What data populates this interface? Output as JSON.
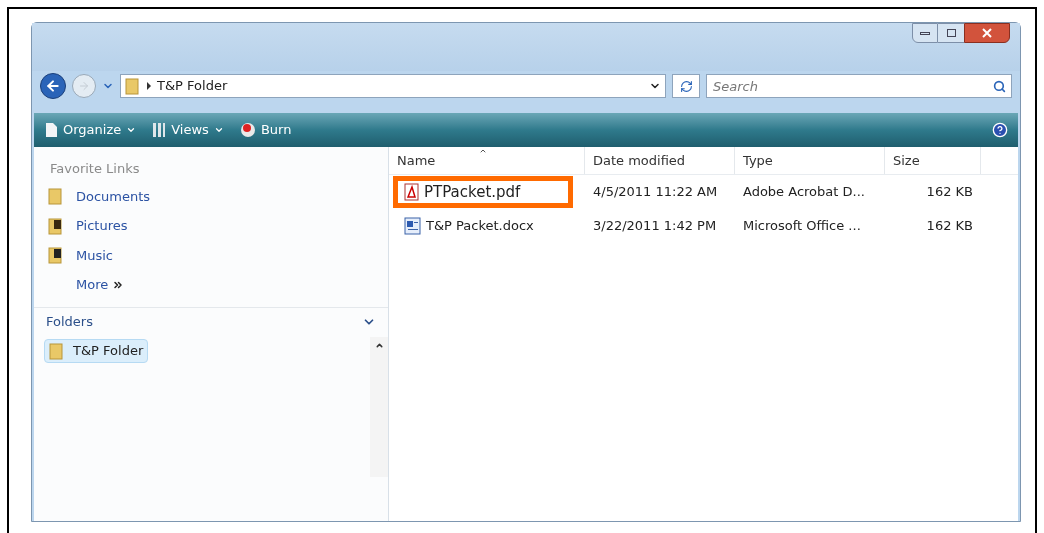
{
  "address_bar": {
    "path": "T&P Folder"
  },
  "search": {
    "placeholder": "Search"
  },
  "toolbar": [
    {
      "kind": "organize",
      "label": "Organize"
    },
    {
      "kind": "views",
      "label": "Views"
    },
    {
      "kind": "burn",
      "label": "Burn"
    }
  ],
  "sidebar": {
    "favorites_title": "Favorite Links",
    "links": [
      {
        "kind": "documents",
        "label": "Documents"
      },
      {
        "kind": "pictures",
        "label": "Pictures"
      },
      {
        "kind": "music",
        "label": "Music"
      }
    ],
    "more": "More",
    "folders_title": "Folders",
    "tree": [
      {
        "label": "T&P Folder",
        "selected": true
      }
    ]
  },
  "table": {
    "columns": [
      "Name",
      "Date modified",
      "Type",
      "Size"
    ],
    "rows": [
      {
        "kind": "pdf",
        "name": "PTPacket.pdf",
        "date": "4/5/2011 11:22 AM",
        "type": "Adobe Acrobat D...",
        "size": "162 KB",
        "highlighted": true
      },
      {
        "kind": "docx",
        "name": "T&P Packet.docx",
        "date": "3/22/2011 1:42 PM",
        "type": "Microsoft Office ...",
        "size": "162 KB",
        "highlighted": false
      }
    ]
  }
}
